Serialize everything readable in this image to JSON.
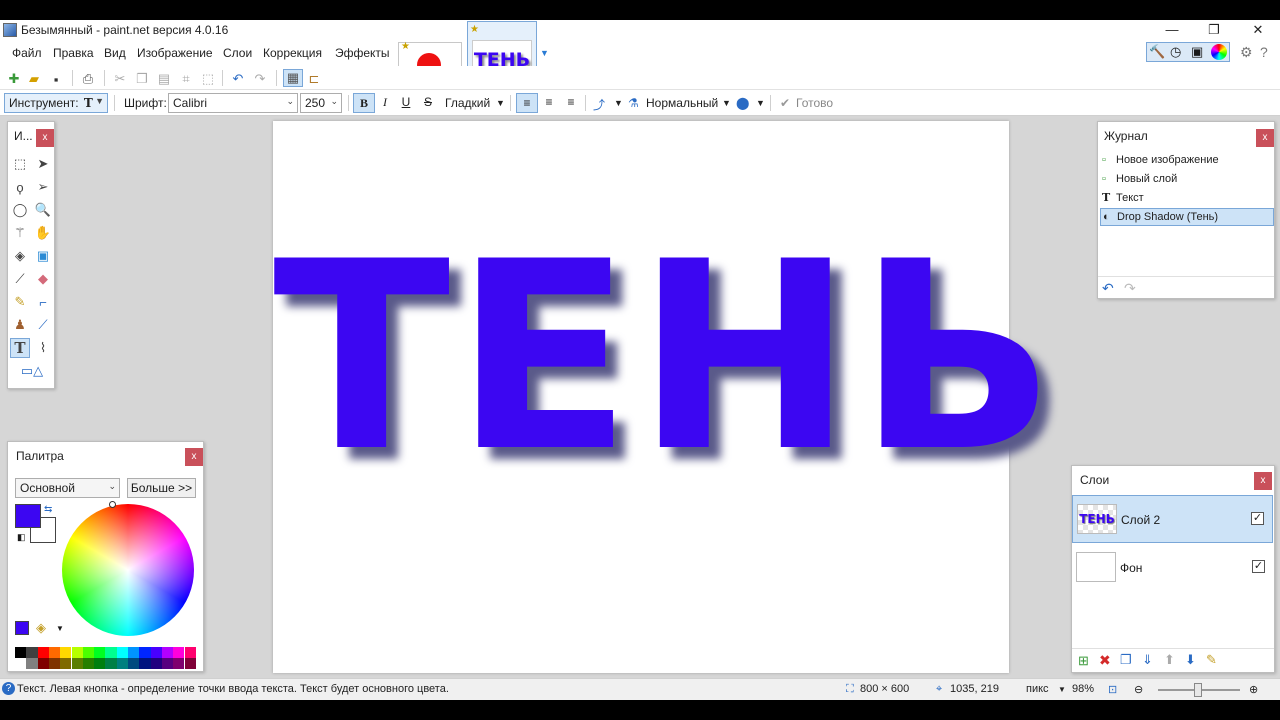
{
  "window": {
    "title": "Безымянный - paint.net версия 4.0.16",
    "minimize": "—",
    "maximize": "❐",
    "close": "✕"
  },
  "menu": [
    "Файл",
    "Правка",
    "Вид",
    "Изображение",
    "Слои",
    "Коррекция",
    "Эффекты"
  ],
  "tabs": [
    {
      "kind": "red-dot-image"
    },
    {
      "kind": "text-image",
      "text": "ТЕНЬ"
    }
  ],
  "tool_options": {
    "tool_label": "Инструмент:",
    "font_label": "Шрифт:",
    "font_value": "Calibri",
    "size_value": "250",
    "bold": "B",
    "italic": "I",
    "underline": "U",
    "strike": "S",
    "smoothing": "Гладкий",
    "blend_mode": "Нормальный",
    "finish": "Готово"
  },
  "canvas": {
    "text": "ТЕНЬ",
    "text_color": "#3c06f2",
    "shadow_color": "#4a4a8a"
  },
  "tools_panel": {
    "title": "И..."
  },
  "history": {
    "title": "Журнал",
    "items": [
      {
        "label": "Новое изображение",
        "icon": "new-image-icon"
      },
      {
        "label": "Новый слой",
        "icon": "new-layer-icon"
      },
      {
        "label": "Текст",
        "icon": "text-tool-icon"
      },
      {
        "label": "Drop Shadow (Тень)",
        "icon": "effect-icon"
      }
    ]
  },
  "palette": {
    "title": "Палитра",
    "preset": "Основной",
    "more_button": "Больше >>",
    "primary_color": "#3c06f2",
    "secondary_color": "#ffffff",
    "swatches_top": [
      "#000000",
      "#404040",
      "#ff0000",
      "#ff6a00",
      "#ffd800",
      "#b6ff00",
      "#4cff00",
      "#00ff21",
      "#00ff90",
      "#00ffff",
      "#0094ff",
      "#0026ff",
      "#4800ff",
      "#b200ff",
      "#ff00dc",
      "#ff006e"
    ],
    "swatches_bottom": [
      "#ffffff",
      "#808080",
      "#7f0000",
      "#7f3300",
      "#7f6a00",
      "#5b7f00",
      "#267f00",
      "#007f0e",
      "#007f46",
      "#007f7f",
      "#004a7f",
      "#00137f",
      "#21007f",
      "#57007f",
      "#7f006e",
      "#7f0037"
    ]
  },
  "layers": {
    "title": "Слои",
    "items": [
      {
        "name": "Слой 2",
        "thumb_text": "ТЕНЬ",
        "visible": "✓"
      },
      {
        "name": "Фон",
        "visible": "✓"
      }
    ]
  },
  "status": {
    "hint": "Текст. Левая кнопка - определение точки ввода текста. Текст будет основного цвета.",
    "image_size": "800 × 600",
    "cursor": "1035, 219",
    "units": "пикс",
    "zoom": "98%"
  }
}
